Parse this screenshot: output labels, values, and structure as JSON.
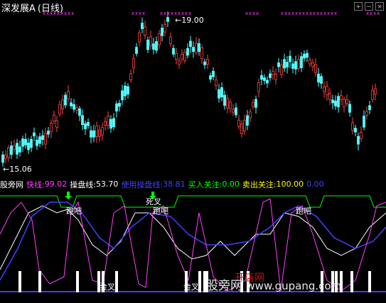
{
  "header": {
    "symbol": "深发展A",
    "period": "(日线)"
  },
  "window_buttons": [
    "+",
    "−",
    "×"
  ],
  "price_chart": {
    "high_label": "19.00",
    "low_label": "←15.06",
    "high_arrow": "←",
    "colors": {
      "up": "#ff4444",
      "down": "#54ffff",
      "marker": "#ff40ff"
    }
  },
  "indicator": {
    "source": "股旁网",
    "fast_label": "快线:",
    "fast_value": "99.02",
    "trade_label": "操盘线:",
    "trade_value": "53.70",
    "tool_label": "使用操盘线:",
    "tool_value": "38.81",
    "buy_label": "买入关注:",
    "buy_value": "0.00",
    "sell_label": "卖出关注:",
    "sell_value": "100.00",
    "extra_value": "0.00",
    "colors": {
      "fast": "#ff40ff",
      "trade": "#ffffff",
      "tool": "#4040ff",
      "buy": "#00ff00",
      "sell": "#ffff00",
      "extra": "#4040ff"
    }
  },
  "annotations": {
    "run1": "跑吧",
    "run2": "跑吧",
    "run3": "跑吧",
    "dead_cross": "死叉",
    "gold_cross1": "金叉",
    "gold_cross2": "金叉"
  },
  "watermark": {
    "text": "股旁网",
    "domain": "www.gupang.com",
    "red_text": "开店网"
  }
}
